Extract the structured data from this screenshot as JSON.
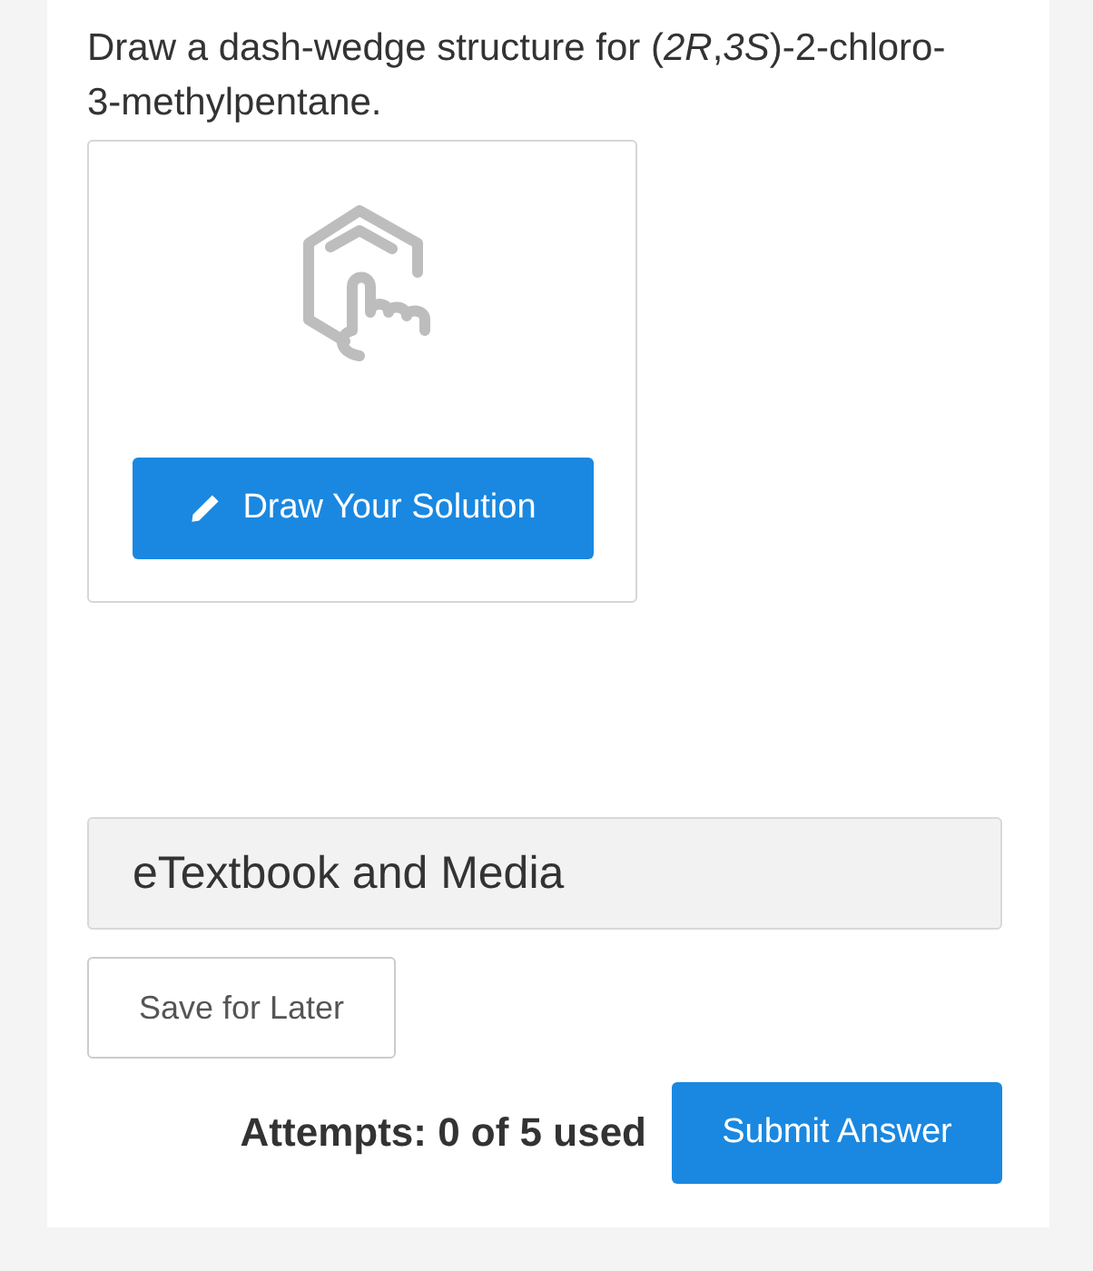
{
  "question": "Draw a dash-wedge structure for (*2R*,*3S*)-2-chloro-3-methylpentane.",
  "draw_button": "Draw Your Solution",
  "resources": "eTextbook and Media",
  "save_button": "Save for Later",
  "attempts": "Attempts: 0 of 5 used",
  "submit_button": "Submit Answer"
}
